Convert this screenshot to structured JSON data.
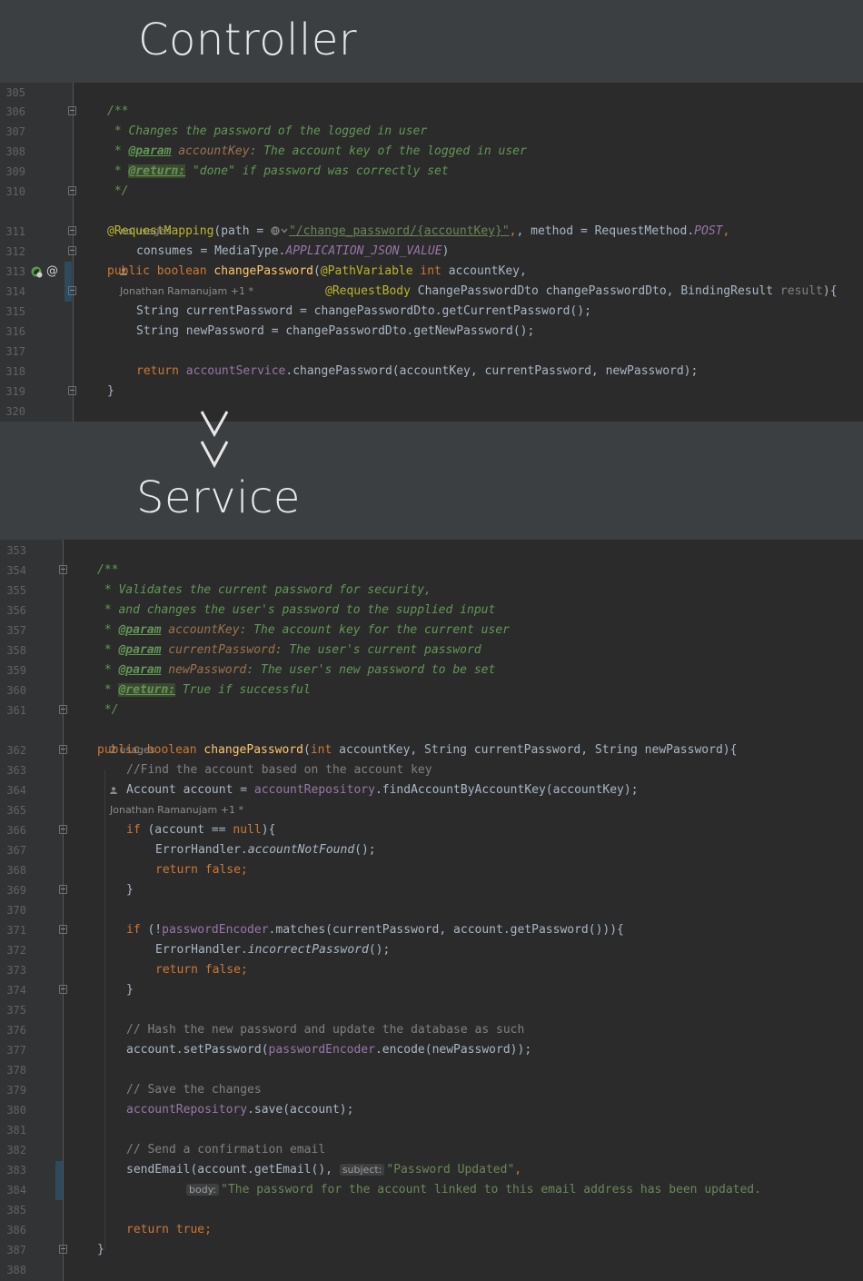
{
  "headings": {
    "controller": "Controller",
    "service": "Service"
  },
  "controller": {
    "line_numbers": [
      "305",
      "306",
      "307",
      "308",
      "309",
      "310",
      "311",
      "312",
      "313",
      "314",
      "315",
      "316",
      "317",
      "318",
      "319",
      "320"
    ],
    "inlay": {
      "usages": "no usages",
      "author": "Jonathan Ramanujam +1 *"
    },
    "doc": {
      "open": "/**",
      "desc": " * Changes the password of the logged in user",
      "param_tag": "@param",
      "param_name": "accountKey",
      "param_desc": ": The account key of the logged in user",
      "return_tag": "@return:",
      "return_desc": " \"done\" if password was correctly set",
      "close": " */"
    },
    "code": {
      "mapping_ann": "@RequestMapping",
      "mapping_path_key": "(path = ",
      "mapping_path": "\"/change_password/{accountKey}\"",
      "mapping_method": ", method = RequestMethod.",
      "mapping_post": "POST",
      "mapping_end": ",",
      "consumes": "consumes = MediaType.",
      "consumes_const": "APPLICATION_JSON_VALUE",
      "consumes_end": ")",
      "sig_public": "public boolean ",
      "sig_name": "changePassword",
      "sig_open": "(",
      "sig_pathvar": "@PathVariable ",
      "sig_int": "int ",
      "sig_param1": "accountKey,",
      "sig2_reqbody": "@RequestBody ",
      "sig2_rest": "ChangePasswordDto changePasswordDto, BindingResult ",
      "sig2_result": "result",
      "sig2_end": "){",
      "line315": "String currentPassword = changePasswordDto.getCurrentPassword();",
      "line316": "String newPassword = changePasswordDto.getNewPassword();",
      "line318_return": "return ",
      "line318_field": "accountService",
      "line318_rest": ".changePassword(accountKey, currentPassword, newPassword);",
      "line319": "}"
    }
  },
  "service": {
    "line_numbers": [
      "353",
      "354",
      "355",
      "356",
      "357",
      "358",
      "359",
      "360",
      "361",
      "362",
      "363",
      "364",
      "365",
      "366",
      "367",
      "368",
      "369",
      "370",
      "371",
      "372",
      "373",
      "374",
      "375",
      "376",
      "377",
      "378",
      "379",
      "380",
      "381",
      "382",
      "383",
      "384",
      "385",
      "386",
      "387",
      "388"
    ],
    "inlay": {
      "usages": "2 usages",
      "author": "Jonathan Ramanujam +1 *"
    },
    "doc": {
      "open": "/**",
      "desc1": " * Validates the current password for security,",
      "desc2": " * and changes the user's password to the supplied input",
      "p1_name": "accountKey",
      "p1_desc": ": The account key for the current user",
      "p2_name": "currentPassword",
      "p2_desc": ": The user's current password",
      "p3_name": "newPassword",
      "p3_desc": ": The user's new password to be set",
      "param_tag": "@param",
      "return_tag": "@return:",
      "return_desc": " True if successful",
      "star": " * ",
      "close": " */"
    },
    "code": {
      "sig_public": "public boolean ",
      "sig_name": "changePassword",
      "sig_open": "(",
      "sig_int": "int ",
      "sig_rest": "accountKey, String currentPassword, String newPassword){",
      "c363": "//Find the account based on the account key",
      "l364_a": "Account account = ",
      "l364_field": "accountRepository",
      "l364_b": ".findAccountByAccountKey(accountKey);",
      "l366_if": "if ",
      "l366_a": "(account == ",
      "l366_null": "null",
      "l366_b": "){",
      "l367_a": "ErrorHandler.",
      "l367_m": "accountNotFound",
      "l367_b": "();",
      "ret_false_kw": "return false",
      "semi": ";",
      "brace": "}",
      "l371_if": "if ",
      "l371_a": "(!",
      "l371_field": "passwordEncoder",
      "l371_b": ".matches(currentPassword, account.getPassword())){",
      "l372_a": "ErrorHandler.",
      "l372_m": "incorrectPassword",
      "l372_b": "();",
      "c376": "// Hash the new password and update the database as such",
      "l377_a": "account.setPassword(",
      "l377_field": "passwordEncoder",
      "l377_b": ".encode(newPassword));",
      "c379": "// Save the changes",
      "l380_field": "accountRepository",
      "l380_b": ".save(account);",
      "c382": "// Send a confirmation email",
      "l383_a": "sendEmail(account.getEmail(), ",
      "l383_hint": "subject:",
      "l383_str": "\"Password Updated\"",
      "l383_end": ",",
      "l384_hint": "body:",
      "l384_str": "\"The password for the account linked to this email address has been updated.",
      "l386_kw": "return true",
      "l387": "}"
    }
  }
}
